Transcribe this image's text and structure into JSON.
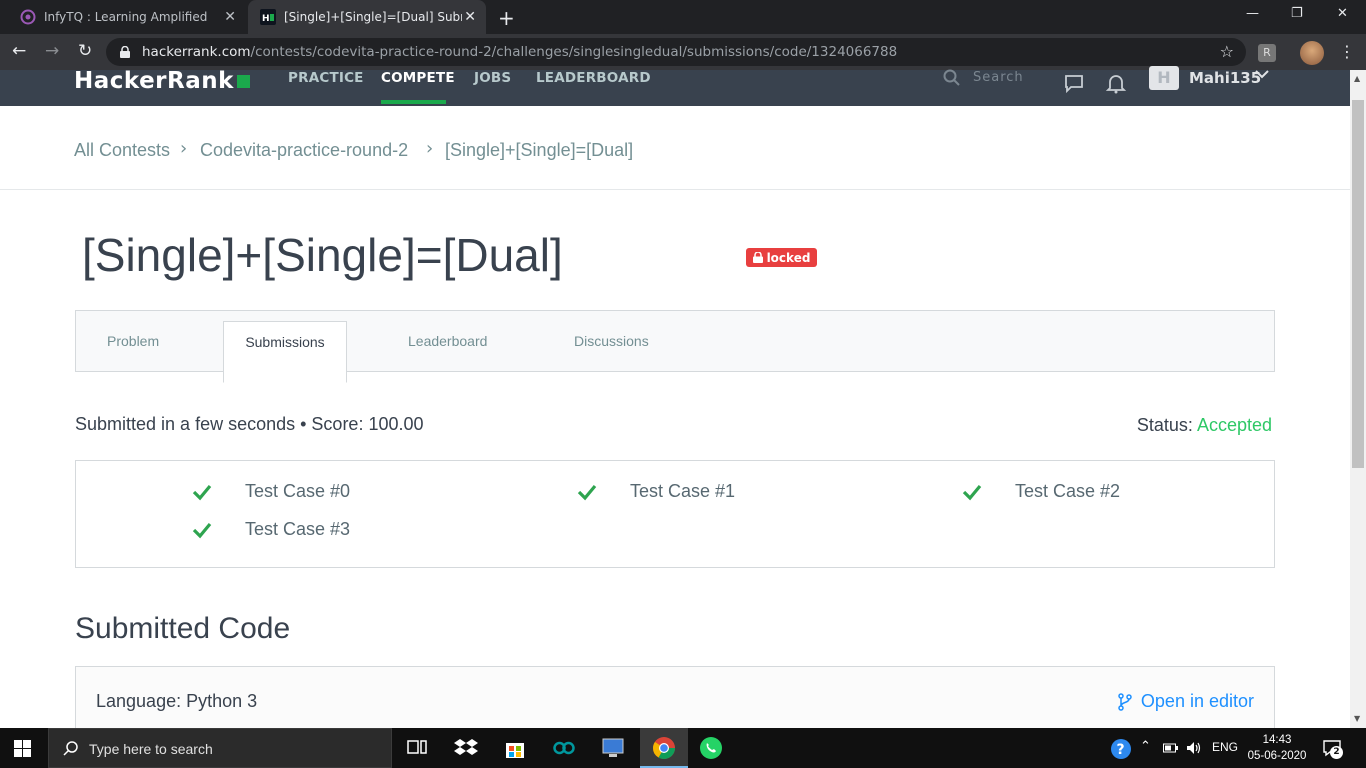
{
  "browser": {
    "tabs": [
      {
        "title": "InfyTQ : Learning Amplified",
        "active": false
      },
      {
        "title": "[Single]+[Single]=[Dual] Submiss",
        "active": true
      }
    ],
    "url_host": "hackerrank.com",
    "url_path": "/contests/codevita-practice-round-2/challenges/singlesingledual/submissions/code/1324066788"
  },
  "header": {
    "logo": "HackerRank",
    "nav": [
      "PRACTICE",
      "COMPETE",
      "JOBS",
      "LEADERBOARD"
    ],
    "active_nav": "COMPETE",
    "search_placeholder": "Search",
    "avatar_letter": "H",
    "username": "Mahi135"
  },
  "breadcrumb": [
    "All Contests",
    "Codevita-practice-round-2",
    "[Single]+[Single]=[Dual]"
  ],
  "challenge": {
    "title": "[Single]+[Single]=[Dual]",
    "badge": "locked"
  },
  "tabs": [
    "Problem",
    "Submissions",
    "Leaderboard",
    "Discussions"
  ],
  "active_tab": "Submissions",
  "submission": {
    "meta": "Submitted in a few seconds • Score: 100.00",
    "status_label": "Status:",
    "status_value": "Accepted",
    "test_cases": [
      "Test Case #0",
      "Test Case #1",
      "Test Case #2",
      "Test Case #3"
    ]
  },
  "code_section": {
    "title": "Submitted Code",
    "language": "Language: Python 3",
    "open_editor": "Open in editor"
  },
  "taskbar": {
    "search_placeholder": "Type here to search",
    "language": "ENG",
    "time": "14:43",
    "date": "05-06-2020",
    "notification_count": "2"
  },
  "colors": {
    "header_bg": "#39424e",
    "brand_green": "#1ba94c",
    "accepted": "#2ec866",
    "badge_red": "#e83f3f",
    "link_blue": "#1e90ff"
  }
}
